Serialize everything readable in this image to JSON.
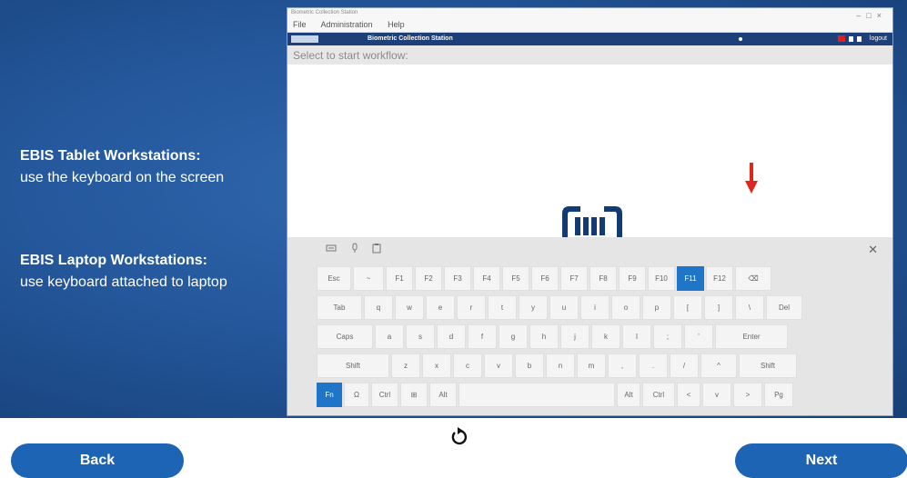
{
  "left_panel": {
    "tablet_heading": "EBIS Tablet Workstations:",
    "tablet_body": "use the keyboard on the screen",
    "laptop_heading": "EBIS Laptop Workstations:",
    "laptop_body": "use keyboard attached to laptop"
  },
  "app": {
    "window_title": "Biometric Collection Station",
    "menus": [
      "File",
      "Administration",
      "Help"
    ],
    "title": "Biometric Collection Station",
    "user": "logout",
    "workflow_prompt": "Select to start workflow:"
  },
  "keyboard": {
    "row1": [
      "Esc",
      "~",
      "F1",
      "F2",
      "F3",
      "F4",
      "F5",
      "F6",
      "F7",
      "F8",
      "F9",
      "F10",
      "F11",
      "F12",
      "⌫"
    ],
    "row1_active": "F11",
    "row2": [
      "Tab",
      "q",
      "w",
      "e",
      "r",
      "t",
      "y",
      "u",
      "i",
      "o",
      "p",
      "[",
      "]",
      "\\",
      "Del"
    ],
    "row3": [
      "Caps",
      "a",
      "s",
      "d",
      "f",
      "g",
      "h",
      "j",
      "k",
      "l",
      ";",
      "'",
      "Enter"
    ],
    "row4": [
      "Shift",
      "z",
      "x",
      "c",
      "v",
      "b",
      "n",
      "m",
      ",",
      ".",
      "/",
      "^",
      "Shift"
    ],
    "row5": [
      "Fn",
      "Ω",
      "Ctrl",
      "⊞",
      "Alt",
      "",
      "Alt",
      "Ctrl",
      "<",
      "v",
      ">",
      "Pg"
    ]
  },
  "navigation": {
    "back_label": "Back",
    "next_label": "Next"
  },
  "colors": {
    "slide_blue": "#24579b",
    "button_blue": "#1e64b4",
    "app_bar": "#1d3f7a",
    "key_active": "#1f76c9",
    "arrow_red": "#e0261e"
  }
}
